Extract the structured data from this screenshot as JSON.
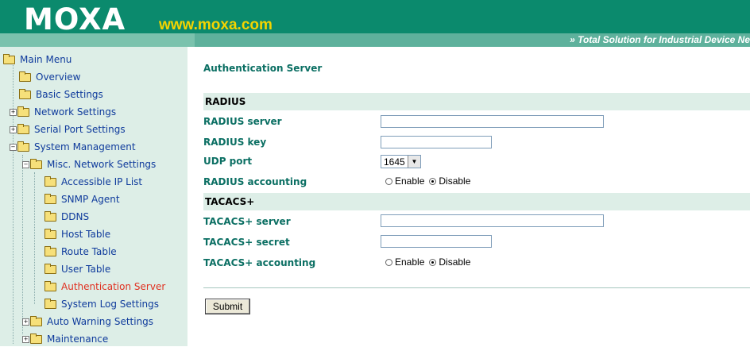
{
  "header": {
    "logo": "MOXA",
    "url": "www.moxa.com",
    "tagline": "» Total Solution for Industrial Device Ne"
  },
  "sidebar": {
    "items": [
      {
        "label": "Main Menu"
      },
      {
        "label": "Overview"
      },
      {
        "label": "Basic Settings"
      },
      {
        "label": "Network Settings"
      },
      {
        "label": "Serial Port Settings"
      },
      {
        "label": "System Management"
      },
      {
        "label": "Misc. Network Settings"
      },
      {
        "label": "Accessible IP List"
      },
      {
        "label": "SNMP Agent"
      },
      {
        "label": "DDNS"
      },
      {
        "label": "Host Table"
      },
      {
        "label": "Route Table"
      },
      {
        "label": "User Table"
      },
      {
        "label": "Authentication Server"
      },
      {
        "label": "System Log Settings"
      },
      {
        "label": "Auto Warning Settings"
      },
      {
        "label": "Maintenance"
      }
    ]
  },
  "main": {
    "title": "Authentication Server",
    "radius": {
      "section": "RADIUS",
      "server_label": "RADIUS server",
      "server_value": "",
      "key_label": "RADIUS key",
      "key_value": "",
      "udp_label": "UDP port",
      "udp_value": "1645",
      "accounting_label": "RADIUS accounting",
      "enable": "Enable",
      "disable": "Disable",
      "accounting_selected": "Disable"
    },
    "tacacs": {
      "section": "TACACS+",
      "server_label": "TACACS+ server",
      "server_value": "",
      "secret_label": "TACACS+ secret",
      "secret_value": "",
      "accounting_label": "TACACS+ accounting",
      "enable": "Enable",
      "disable": "Disable",
      "accounting_selected": "Disable"
    },
    "submit": "Submit"
  }
}
